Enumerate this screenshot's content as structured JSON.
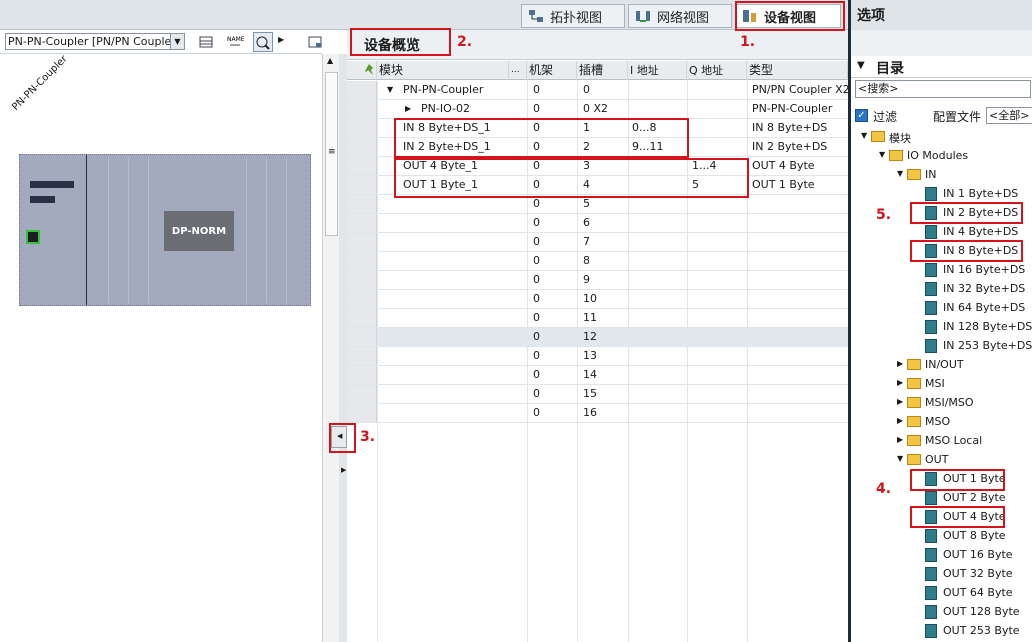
{
  "view_tabs": [
    {
      "label": "拓扑视图"
    },
    {
      "label": "网络视图"
    },
    {
      "label": "设备视图"
    }
  ],
  "left": {
    "device_select": "PN-PN-Coupler [PN/PN Coupler",
    "device_label": "PN-PN-Coupler",
    "module_label": "DP-NORM"
  },
  "overview": {
    "title": "设备概览",
    "columns": [
      "模块",
      "...",
      "机架",
      "插槽",
      "I 地址",
      "Q 地址",
      "类型"
    ],
    "rows": [
      {
        "module": "PN-PN-Coupler",
        "rack": "0",
        "slot": "0",
        "i_addr": "",
        "q_addr": "",
        "type": "PN/PN Coupler X2"
      },
      {
        "module": "PN-IO-02",
        "rack": "0",
        "slot": "0 X2",
        "i_addr": "",
        "q_addr": "",
        "type": "PN-PN-Coupler"
      },
      {
        "module": "IN  8 Byte+DS_1",
        "rack": "0",
        "slot": "1",
        "i_addr": "0...8",
        "q_addr": "",
        "type": "IN  8 Byte+DS"
      },
      {
        "module": "IN  2 Byte+DS_1",
        "rack": "0",
        "slot": "2",
        "i_addr": "9...11",
        "q_addr": "",
        "type": "IN  2 Byte+DS"
      },
      {
        "module": "OUT  4 Byte_1",
        "rack": "0",
        "slot": "3",
        "i_addr": "",
        "q_addr": "1...4",
        "type": "OUT  4 Byte"
      },
      {
        "module": "OUT  1 Byte_1",
        "rack": "0",
        "slot": "4",
        "i_addr": "",
        "q_addr": "5",
        "type": "OUT  1 Byte"
      },
      {
        "module": "",
        "rack": "0",
        "slot": "5",
        "i_addr": "",
        "q_addr": "",
        "type": ""
      },
      {
        "module": "",
        "rack": "0",
        "slot": "6",
        "i_addr": "",
        "q_addr": "",
        "type": ""
      },
      {
        "module": "",
        "rack": "0",
        "slot": "7",
        "i_addr": "",
        "q_addr": "",
        "type": ""
      },
      {
        "module": "",
        "rack": "0",
        "slot": "8",
        "i_addr": "",
        "q_addr": "",
        "type": ""
      },
      {
        "module": "",
        "rack": "0",
        "slot": "9",
        "i_addr": "",
        "q_addr": "",
        "type": ""
      },
      {
        "module": "",
        "rack": "0",
        "slot": "10",
        "i_addr": "",
        "q_addr": "",
        "type": ""
      },
      {
        "module": "",
        "rack": "0",
        "slot": "11",
        "i_addr": "",
        "q_addr": "",
        "type": ""
      },
      {
        "module": "",
        "rack": "0",
        "slot": "12",
        "i_addr": "",
        "q_addr": "",
        "type": ""
      },
      {
        "module": "",
        "rack": "0",
        "slot": "13",
        "i_addr": "",
        "q_addr": "",
        "type": ""
      },
      {
        "module": "",
        "rack": "0",
        "slot": "14",
        "i_addr": "",
        "q_addr": "",
        "type": ""
      },
      {
        "module": "",
        "rack": "0",
        "slot": "15",
        "i_addr": "",
        "q_addr": "",
        "type": ""
      },
      {
        "module": "",
        "rack": "0",
        "slot": "16",
        "i_addr": "",
        "q_addr": "",
        "type": ""
      }
    ]
  },
  "catalog": {
    "panel_title": "选项",
    "title": "目录",
    "search": "<搜索>",
    "filter_label": "过滤",
    "profile_label": "配置文件",
    "profile_value": "<全部>",
    "tree": [
      {
        "label": "模块",
        "kind": "folder",
        "level": 0,
        "open": true
      },
      {
        "label": "IO Modules",
        "kind": "folder",
        "level": 1,
        "open": true
      },
      {
        "label": "IN",
        "kind": "folder",
        "level": 2,
        "open": true
      },
      {
        "label": "IN   1 Byte+DS",
        "kind": "module",
        "level": 3
      },
      {
        "label": "IN   2 Byte+DS",
        "kind": "module",
        "level": 3
      },
      {
        "label": "IN   4 Byte+DS",
        "kind": "module",
        "level": 3
      },
      {
        "label": "IN   8 Byte+DS",
        "kind": "module",
        "level": 3
      },
      {
        "label": "IN  16 Byte+DS",
        "kind": "module",
        "level": 3
      },
      {
        "label": "IN  32 Byte+DS",
        "kind": "module",
        "level": 3
      },
      {
        "label": "IN  64 Byte+DS",
        "kind": "module",
        "level": 3
      },
      {
        "label": "IN 128 Byte+DS",
        "kind": "module",
        "level": 3
      },
      {
        "label": "IN 253 Byte+DS",
        "kind": "module",
        "level": 3
      },
      {
        "label": "IN/OUT",
        "kind": "folder",
        "level": 2,
        "open": false
      },
      {
        "label": "MSI",
        "kind": "folder",
        "level": 2,
        "open": false
      },
      {
        "label": "MSI/MSO",
        "kind": "folder",
        "level": 2,
        "open": false
      },
      {
        "label": "MSO",
        "kind": "folder",
        "level": 2,
        "open": false
      },
      {
        "label": "MSO Local",
        "kind": "folder",
        "level": 2,
        "open": false
      },
      {
        "label": "OUT",
        "kind": "folder",
        "level": 2,
        "open": true
      },
      {
        "label": "OUT   1 Byte",
        "kind": "module",
        "level": 3
      },
      {
        "label": "OUT   2 Byte",
        "kind": "module",
        "level": 3
      },
      {
        "label": "OUT   4 Byte",
        "kind": "module",
        "level": 3
      },
      {
        "label": "OUT   8 Byte",
        "kind": "module",
        "level": 3
      },
      {
        "label": "OUT  16 Byte",
        "kind": "module",
        "level": 3
      },
      {
        "label": "OUT  32 Byte",
        "kind": "module",
        "level": 3
      },
      {
        "label": "OUT  64 Byte",
        "kind": "module",
        "level": 3
      },
      {
        "label": "OUT 128 Byte",
        "kind": "module",
        "level": 3
      },
      {
        "label": "OUT 253 Byte",
        "kind": "module",
        "level": 3
      }
    ]
  },
  "annotations": {
    "m1": "1.",
    "m2": "2.",
    "m3": "3.",
    "m4": "4.",
    "m5": "5."
  }
}
